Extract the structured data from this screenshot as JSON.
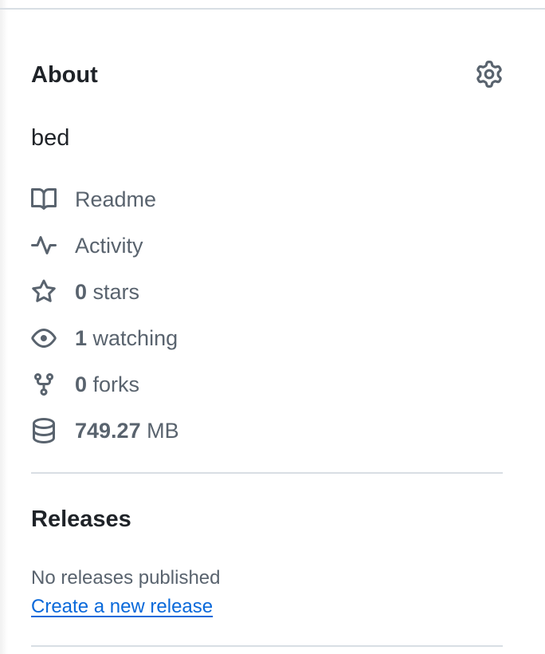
{
  "about": {
    "title": "About",
    "settings_icon": "gear-icon",
    "description": "bed",
    "items": [
      {
        "icon": "book-icon",
        "number": "",
        "label": "Readme"
      },
      {
        "icon": "pulse-icon",
        "number": "",
        "label": "Activity"
      },
      {
        "icon": "star-icon",
        "number": "0",
        "label": " stars"
      },
      {
        "icon": "eye-icon",
        "number": "1",
        "label": " watching"
      },
      {
        "icon": "repo-forked-icon",
        "number": "0",
        "label": " forks"
      },
      {
        "icon": "database-icon",
        "number": "749.27",
        "label": " MB"
      }
    ]
  },
  "releases": {
    "title": "Releases",
    "empty_text": "No releases published",
    "create_link": "Create a new release"
  },
  "colors": {
    "text_primary": "#1f2328",
    "text_muted": "#59636e",
    "link": "#0969da",
    "divider": "#d8dee4"
  }
}
